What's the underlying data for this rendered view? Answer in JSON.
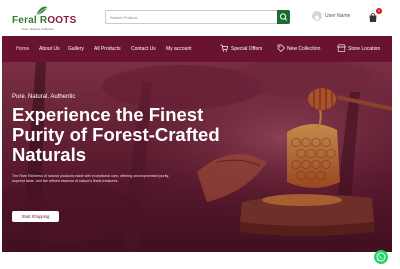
{
  "brand": {
    "name_part1": "Feral R",
    "name_part2": "OOTS",
    "tagline": "Pure. Natural. Authentic"
  },
  "search": {
    "placeholder": "Search Product"
  },
  "user": {
    "name": "User Name"
  },
  "cart": {
    "count": "0"
  },
  "nav": {
    "items": [
      "Home",
      "About Us",
      "Gallery",
      "All Products",
      "Contact Us",
      "My account"
    ],
    "right_items": [
      "Special Offers",
      "New Collection",
      "Store Location"
    ]
  },
  "hero": {
    "eyebrow": "Pure. Natural. Authentic",
    "headline_line1": "Experience the Finest",
    "headline_line2": "Purity of Forest-Crafted",
    "headline_line3": "Naturals",
    "description": "The Rare Richness of natural products made with exceptional care, offering uncompromised purity, superior taste, and the refined essence of nature's finest treasures.",
    "cta": "Start Shopping"
  },
  "colors": {
    "brand_maroon": "#6a1331",
    "brand_green": "#2e7d32",
    "search_button": "#1e6b2e",
    "whatsapp": "#25d366"
  }
}
